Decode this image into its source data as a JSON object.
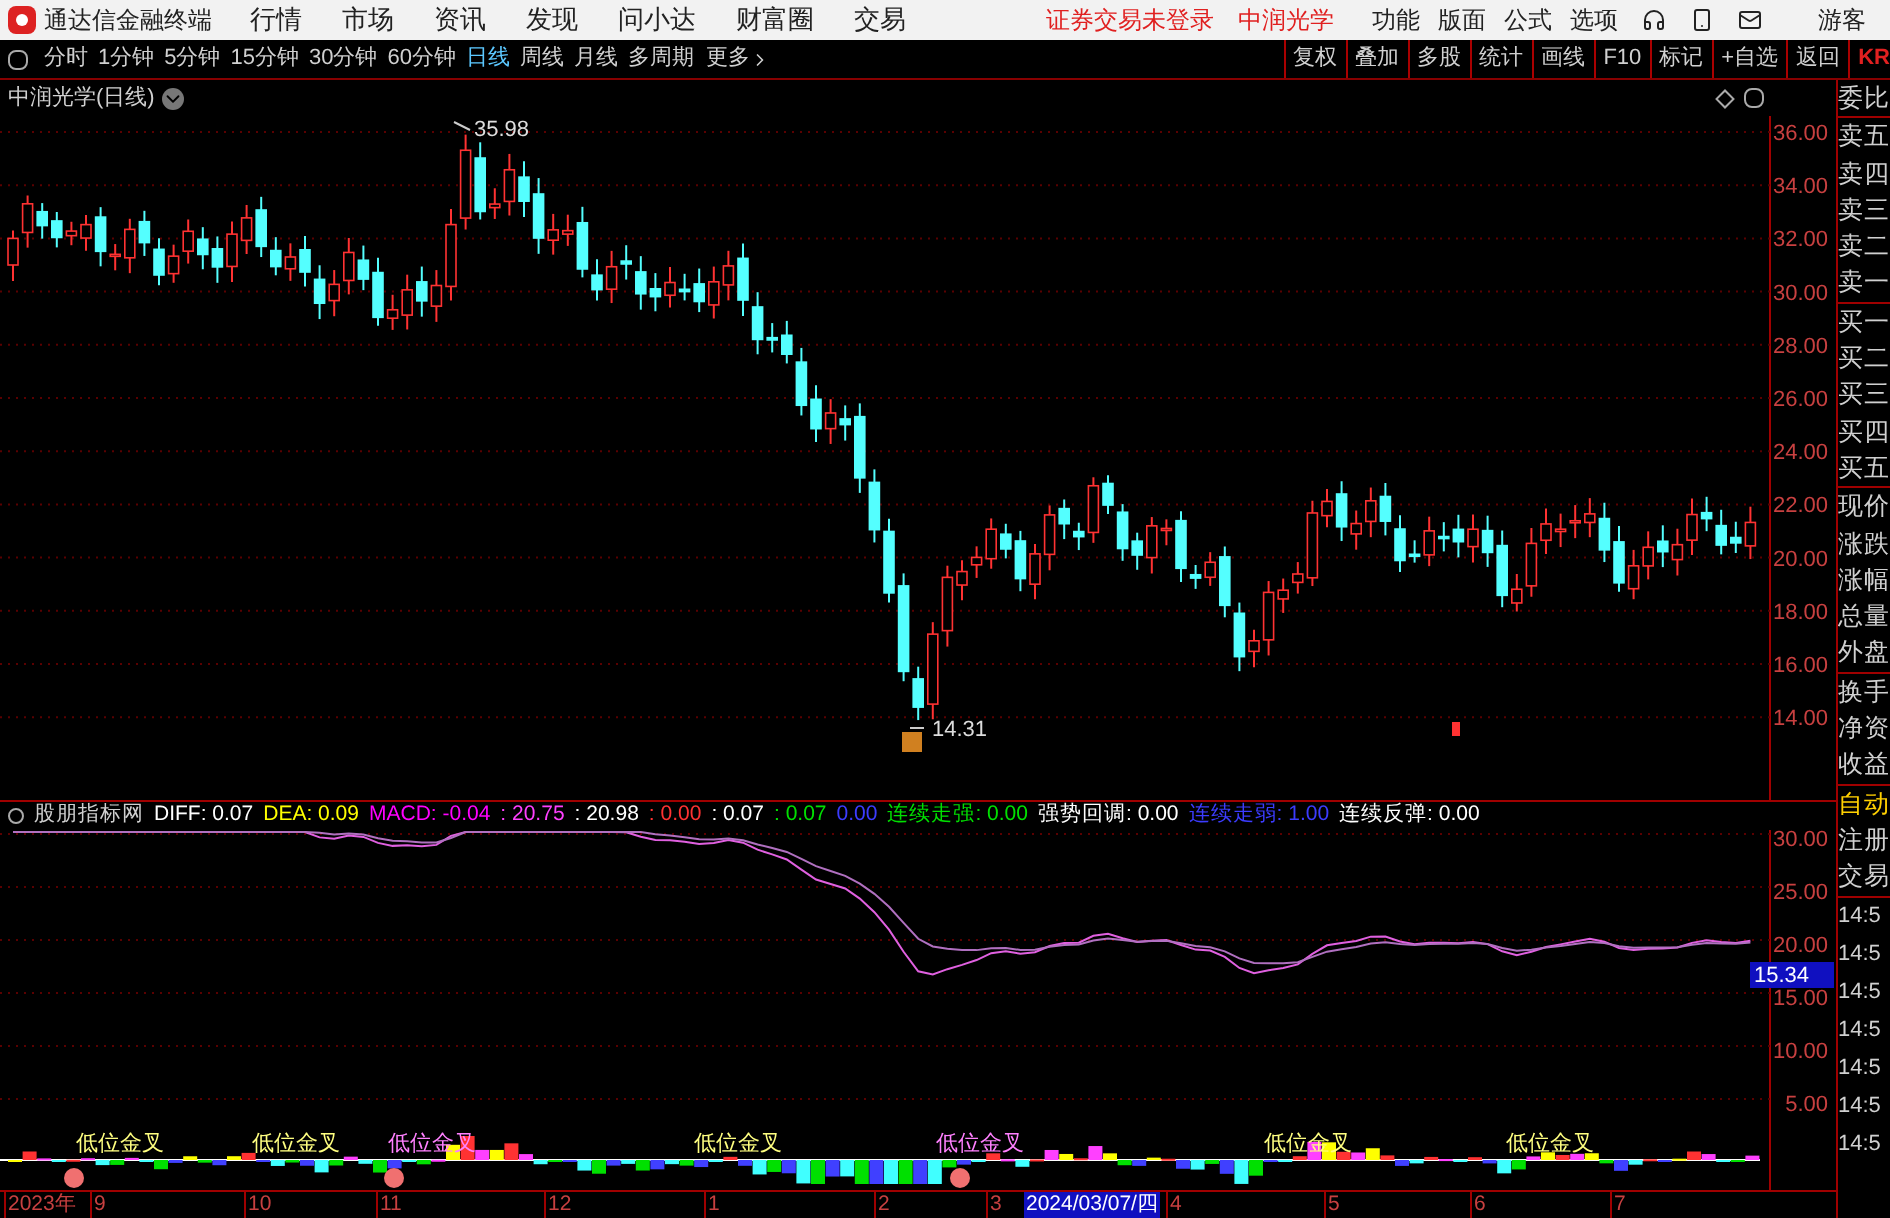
{
  "app": {
    "title": "通达信金融终端"
  },
  "menu": [
    "行情",
    "市场",
    "资讯",
    "发现",
    "问小达",
    "财富圈",
    "交易"
  ],
  "login_status": "证券交易未登录",
  "stock_name": "中润光学",
  "menu_right": [
    "功能",
    "版面",
    "公式",
    "选项"
  ],
  "user": "游客",
  "periods": [
    {
      "label": "分时",
      "selected": false
    },
    {
      "label": "1分钟",
      "selected": false
    },
    {
      "label": "5分钟",
      "selected": false
    },
    {
      "label": "15分钟",
      "selected": false
    },
    {
      "label": "30分钟",
      "selected": false
    },
    {
      "label": "60分钟",
      "selected": false
    },
    {
      "label": "日线",
      "selected": true
    },
    {
      "label": "周线",
      "selected": false
    },
    {
      "label": "月线",
      "selected": false
    },
    {
      "label": "多周期",
      "selected": false
    }
  ],
  "more": "更多",
  "tool_buttons": [
    "复权",
    "叠加",
    "多股",
    "统计",
    "画线",
    "F10",
    "标记",
    "+自选",
    "返回"
  ],
  "toolbar_cut": "KR",
  "chart": {
    "title": "中润光学(日线)",
    "price_axis": [
      "36.00",
      "34.00",
      "32.00",
      "30.00",
      "28.00",
      "26.00",
      "24.00",
      "22.00",
      "20.00",
      "18.00",
      "16.00",
      "14.00"
    ],
    "high_label": "35.98",
    "low_label": "14.31"
  },
  "indicator": {
    "name": "股朋指标网",
    "values": [
      {
        "label": "DIFF: 0.07",
        "color": "#ffffff"
      },
      {
        "label": "DEA: 0.09",
        "color": "#ffff00"
      },
      {
        "label": "MACD: -0.04",
        "color": "#ff00ff"
      },
      {
        "label": ": 20.75",
        "color": "#ff40ff"
      },
      {
        "label": ": 20.98",
        "color": "#ffffff"
      },
      {
        "label": ": 0.00",
        "color": "#ff3232"
      },
      {
        "label": ": 0.07",
        "color": "#ffffff"
      },
      {
        "label": ": 0.07",
        "color": "#00e000"
      },
      {
        "label": "0.00",
        "color": "#3c3cff"
      },
      {
        "label": "连续走强: 0.00",
        "color": "#00e000"
      },
      {
        "label": "强势回调: 0.00",
        "color": "#ffffff"
      },
      {
        "label": "连续走弱: 1.00",
        "color": "#3c3cff"
      },
      {
        "label": "连续反弹: 0.00",
        "color": "#ffffff"
      }
    ],
    "axis": [
      "30.00",
      "25.00",
      "20.00",
      "15.00",
      "10.00",
      "5.00"
    ],
    "marker": "15.34"
  },
  "signals": [
    {
      "label": "低位金叉",
      "color": "#ffff80"
    },
    {
      "label": "低位金叉",
      "color": "#ffff80"
    },
    {
      "label": "低位金叉",
      "color": "#ff80ff"
    },
    {
      "label": "低位金叉",
      "color": "#ffff80"
    },
    {
      "label": "低位金叉",
      "color": "#ff80ff"
    },
    {
      "label": "低位金叉",
      "color": "#ffff80"
    },
    {
      "label": "低位金叉",
      "color": "#ffff80"
    }
  ],
  "date_axis": [
    {
      "label": "2023年",
      "selected": false
    },
    {
      "label": "9",
      "selected": false
    },
    {
      "label": "10",
      "selected": false
    },
    {
      "label": "11",
      "selected": false
    },
    {
      "label": "12",
      "selected": false
    },
    {
      "label": "1",
      "selected": false
    },
    {
      "label": "2",
      "selected": false
    },
    {
      "label": "3",
      "selected": false
    },
    {
      "label": "2024/03/07/四",
      "selected": true
    },
    {
      "label": "4",
      "selected": false
    },
    {
      "label": "5",
      "selected": false
    },
    {
      "label": "6",
      "selected": false
    },
    {
      "label": "7",
      "selected": false
    }
  ],
  "quote_groups": [
    [
      "委比"
    ],
    [
      "卖五",
      "卖四",
      "卖三",
      "卖二",
      "卖一"
    ],
    [
      "买一",
      "买二",
      "买三",
      "买四",
      "买五"
    ],
    [
      "现价",
      "涨跌",
      "涨幅",
      "总量",
      "外盘"
    ],
    [
      "换手",
      "净资",
      "收益"
    ]
  ],
  "panel_actions": [
    {
      "label": "自动",
      "selected": true
    },
    {
      "label": "注册",
      "selected": false
    },
    {
      "label": "交易",
      "selected": false
    }
  ],
  "times": [
    "14:5",
    "14:5",
    "14:5",
    "14:5",
    "14:5",
    "14:5",
    "14:5"
  ]
}
